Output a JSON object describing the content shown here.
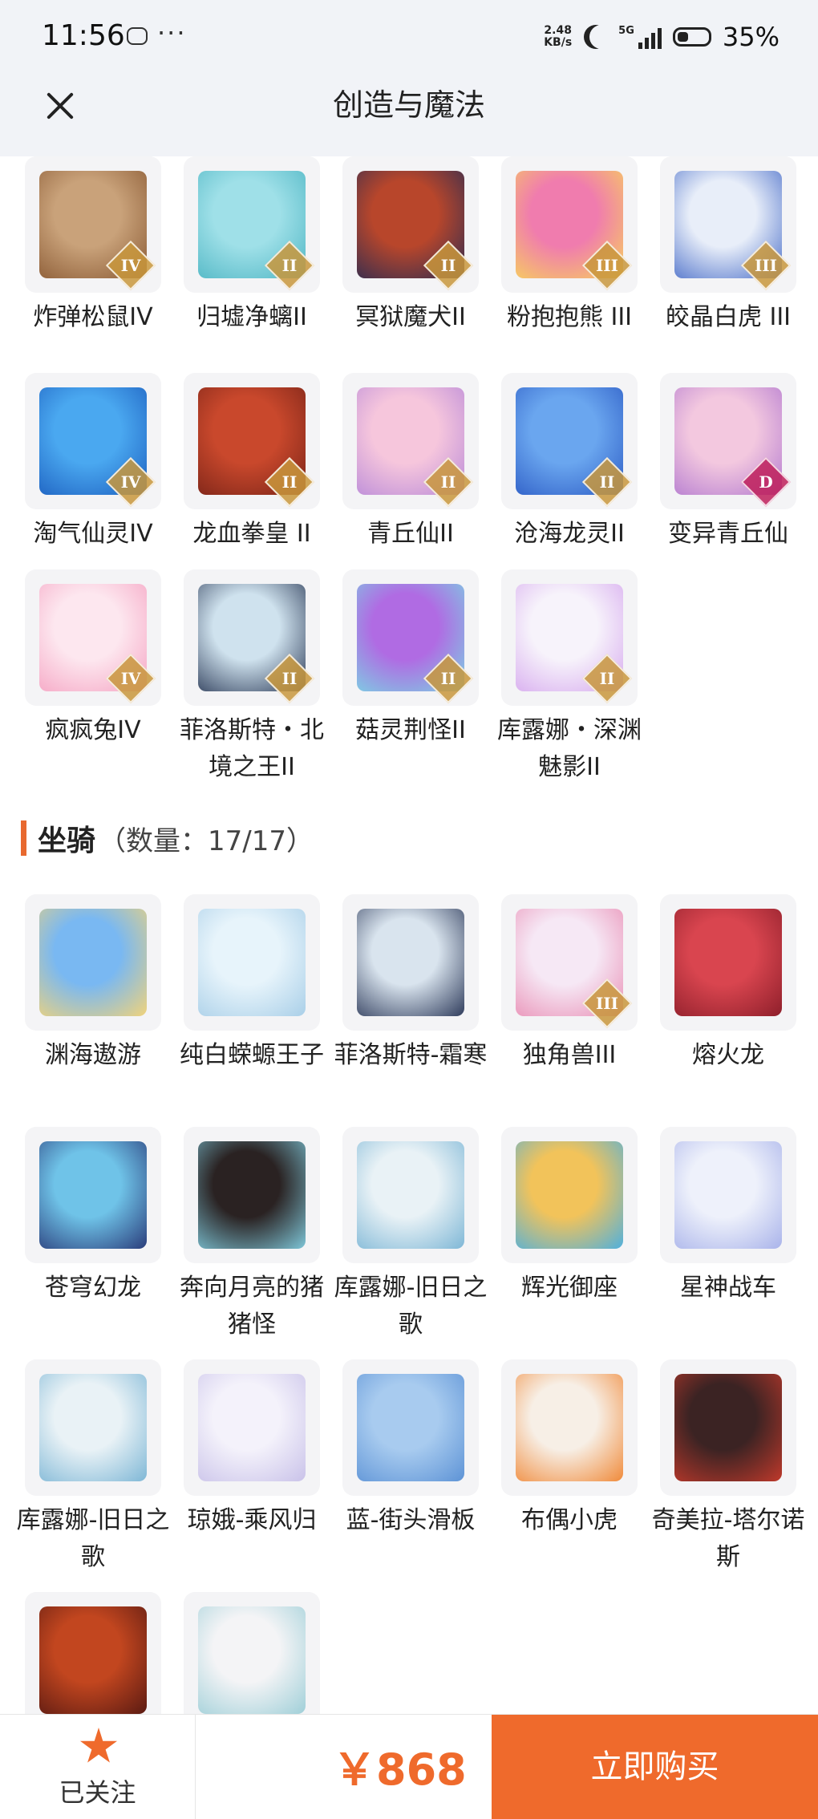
{
  "status_bar": {
    "time": "11:56",
    "more": "···",
    "net_speed_value": "2.48",
    "net_speed_unit": "KB/s",
    "network": "5G",
    "battery": "35%"
  },
  "header": {
    "title": "创造与魔法",
    "close_icon": "close-icon"
  },
  "pets": {
    "items": [
      {
        "label": "炸弹松鼠IV",
        "rank": "IV",
        "colors": [
          "#c9a27a",
          "#8a5a34"
        ]
      },
      {
        "label": "归墟净螭II",
        "rank": "II",
        "colors": [
          "#9fe0e8",
          "#4fb6c4"
        ]
      },
      {
        "label": "冥狱魔犬II",
        "rank": "II",
        "colors": [
          "#b8462b",
          "#2c2c52"
        ]
      },
      {
        "label": "粉抱抱熊 III",
        "rank": "III",
        "colors": [
          "#f07cae",
          "#f7d35a"
        ]
      },
      {
        "label": "皎晶白虎 III",
        "rank": "III",
        "colors": [
          "#e8eef9",
          "#4b6fc9"
        ]
      },
      {
        "label": "淘气仙灵IV",
        "rank": "IV",
        "colors": [
          "#4aa8f0",
          "#1d5fbf"
        ]
      },
      {
        "label": "龙血拳皇 II",
        "rank": "II",
        "colors": [
          "#c9482c",
          "#7a2418"
        ]
      },
      {
        "label": "青丘仙II",
        "rank": "II",
        "colors": [
          "#f6c6dc",
          "#b98ad9"
        ]
      },
      {
        "label": "沧海龙灵II",
        "rank": "II",
        "colors": [
          "#6aa6ef",
          "#2d5cc5"
        ]
      },
      {
        "label": "变异青丘仙",
        "rank": "D",
        "colors": [
          "#f3c8df",
          "#b37ad0"
        ]
      },
      {
        "label": "疯疯兔IV",
        "rank": "IV",
        "colors": [
          "#fde7ef",
          "#f5a4c3"
        ]
      },
      {
        "label": "菲洛斯特・北境之王II",
        "rank": "II",
        "colors": [
          "#cfe2ee",
          "#2c3b58"
        ]
      },
      {
        "label": "菇灵荆怪II",
        "rank": "II",
        "colors": [
          "#b06be3",
          "#79d6e3"
        ]
      },
      {
        "label": "库露娜・深渊魅影II",
        "rank": "II",
        "colors": [
          "#f7f3fb",
          "#d6a9ee"
        ]
      }
    ]
  },
  "mounts_section": {
    "title": "坐骑",
    "count": "（数量：17/17）"
  },
  "mounts": {
    "items": [
      {
        "label": "渊海遨游",
        "rank": "",
        "colors": [
          "#79b8f2",
          "#f1d37a"
        ]
      },
      {
        "label": "纯白蝾螈王子",
        "rank": "",
        "colors": [
          "#e7f4fb",
          "#a9cfe8"
        ]
      },
      {
        "label": "菲洛斯特-霜寒",
        "rank": "",
        "colors": [
          "#d9e4ee",
          "#2f3c5c"
        ]
      },
      {
        "label": "独角兽III",
        "rank": "III",
        "colors": [
          "#f6e8f5",
          "#e98fb5"
        ]
      },
      {
        "label": "熔火龙",
        "rank": "",
        "colors": [
          "#d9454f",
          "#8e1f2b"
        ]
      },
      {
        "label": "苍穹幻龙",
        "rank": "",
        "colors": [
          "#6fc3e8",
          "#2a3c7a"
        ]
      },
      {
        "label": "奔向月亮的猪猪怪",
        "rank": "",
        "colors": [
          "#2a2222",
          "#7ec6d8"
        ]
      },
      {
        "label": "库露娜-旧日之歌",
        "rank": "",
        "colors": [
          "#e9f2f6",
          "#7eb7d6"
        ]
      },
      {
        "label": "辉光御座",
        "rank": "",
        "colors": [
          "#f2c35a",
          "#4fb0de"
        ]
      },
      {
        "label": "星神战车",
        "rank": "",
        "colors": [
          "#eef1fb",
          "#a9b3ea"
        ]
      },
      {
        "label": "库露娜-旧日之歌",
        "rank": "",
        "colors": [
          "#e9f2f6",
          "#7eb7d6"
        ]
      },
      {
        "label": "琼娥-乘风归",
        "rank": "",
        "colors": [
          "#f4f2fb",
          "#c9c2e9"
        ]
      },
      {
        "label": "蓝-街头滑板",
        "rank": "",
        "colors": [
          "#a8cbef",
          "#5d93d6"
        ]
      },
      {
        "label": "布偶小虎",
        "rank": "",
        "colors": [
          "#f7efe6",
          "#f08a3a"
        ]
      },
      {
        "label": "奇美拉-塔尔诺斯",
        "rank": "",
        "colors": [
          "#3b2323",
          "#c0392b"
        ]
      },
      {
        "label": "",
        "rank": "",
        "colors": [
          "#c2461f",
          "#5a1a12"
        ]
      },
      {
        "label": "",
        "rank": "",
        "colors": [
          "#f4f4f6",
          "#9fcfd8"
        ]
      }
    ]
  },
  "footer": {
    "follow_label": "已关注",
    "follow_icon": "star-icon",
    "price": "￥868",
    "buy_label": "立即购买",
    "accent_color": "#ef6a2c"
  }
}
